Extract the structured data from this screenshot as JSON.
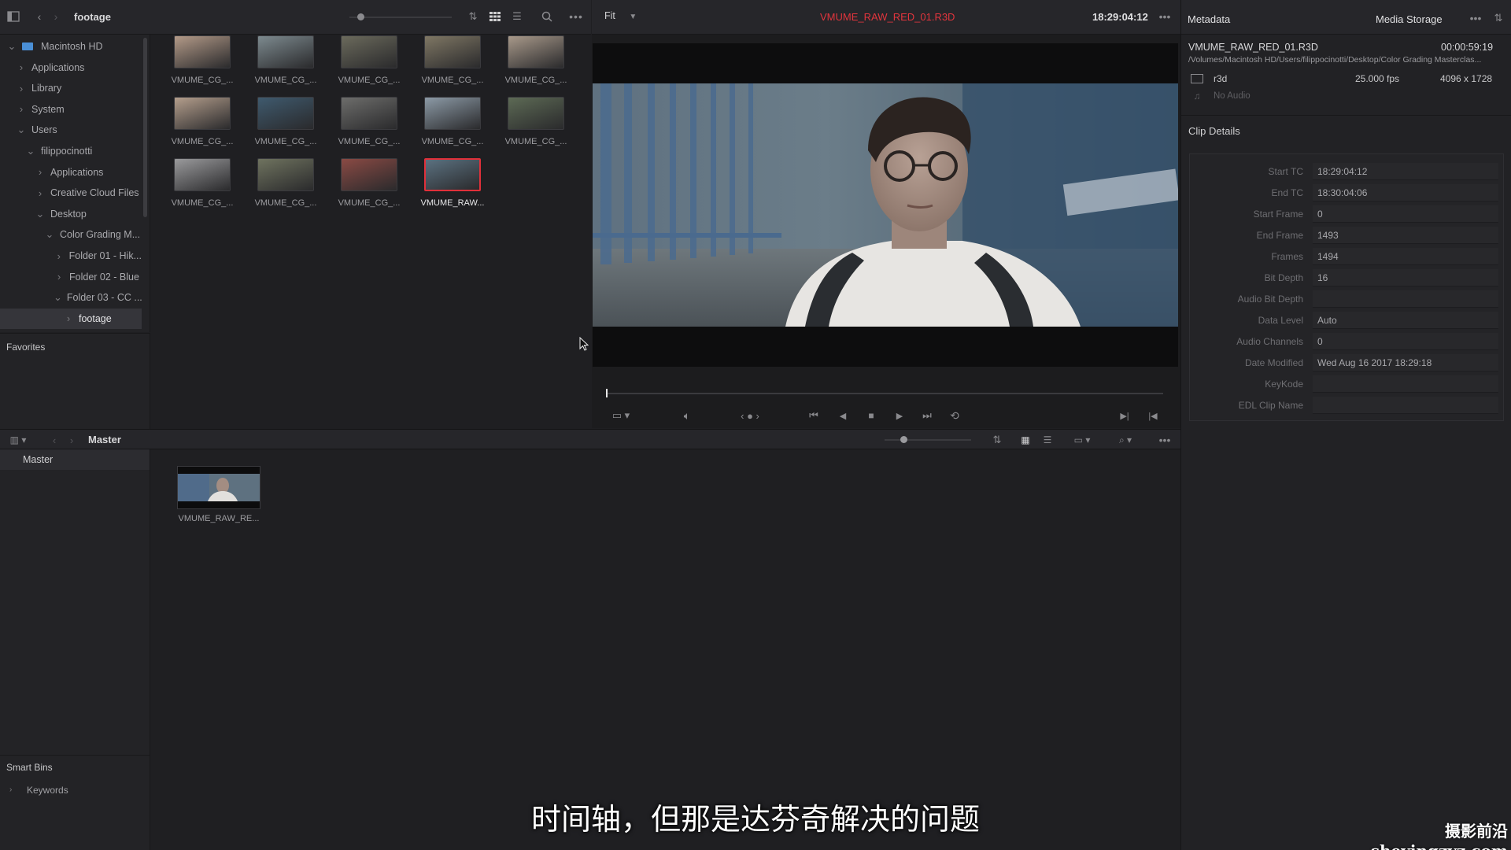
{
  "media_pool": {
    "path_label": "footage",
    "tree": [
      {
        "label": "Macintosh HD",
        "depth": 0,
        "chev": "v",
        "icon": "drive"
      },
      {
        "label": "Applications",
        "depth": 1,
        "chev": ">"
      },
      {
        "label": "Library",
        "depth": 1,
        "chev": ">"
      },
      {
        "label": "System",
        "depth": 1,
        "chev": ">"
      },
      {
        "label": "Users",
        "depth": 1,
        "chev": "v"
      },
      {
        "label": "filippocinotti",
        "depth": 2,
        "chev": "v"
      },
      {
        "label": "Applications",
        "depth": 3,
        "chev": ">"
      },
      {
        "label": "Creative Cloud Files",
        "depth": 3,
        "chev": ">"
      },
      {
        "label": "Desktop",
        "depth": 3,
        "chev": "v"
      },
      {
        "label": "Color Grading M...",
        "depth": 4,
        "chev": "v"
      },
      {
        "label": "Folder 01 - Hik...",
        "depth": 5,
        "chev": ">"
      },
      {
        "label": "Folder 02 - Blue",
        "depth": 5,
        "chev": ">"
      },
      {
        "label": "Folder 03 - CC ...",
        "depth": 5,
        "chev": "v"
      },
      {
        "label": "footage",
        "depth": 6,
        "chev": ">",
        "selected": true
      }
    ],
    "favorites_label": "Favorites",
    "clips": [
      {
        "label": "VMUME_CG_...",
        "color": "#b39a88"
      },
      {
        "label": "VMUME_CG_...",
        "color": "#7d8a8f"
      },
      {
        "label": "VMUME_CG_...",
        "color": "#6b6a5c"
      },
      {
        "label": "VMUME_CG_...",
        "color": "#7f7764"
      },
      {
        "label": "VMUME_CG_...",
        "color": "#a8998a"
      },
      {
        "label": "VMUME_CG_...",
        "color": "#b49e8c"
      },
      {
        "label": "VMUME_CG_...",
        "color": "#3f5a6e"
      },
      {
        "label": "VMUME_CG_...",
        "color": "#6d6d6b"
      },
      {
        "label": "VMUME_CG_...",
        "color": "#8c9aa6"
      },
      {
        "label": "VMUME_CG_...",
        "color": "#5d6a55"
      },
      {
        "label": "VMUME_CG_...",
        "color": "#9a9a9c"
      },
      {
        "label": "VMUME_CG_...",
        "color": "#6f735f"
      },
      {
        "label": "VMUME_CG_...",
        "color": "#8a4a44"
      },
      {
        "label": "VMUME_RAW...",
        "color": "#5b7180",
        "selected": true
      }
    ]
  },
  "viewer": {
    "zoom": "Fit",
    "clip_name": "VMUME_RAW_RED_01.R3D",
    "timecode": "18:29:04:12"
  },
  "metadata": {
    "tab_metadata": "Metadata",
    "tab_media_storage": "Media Storage",
    "file_name": "VMUME_RAW_RED_01.R3D",
    "duration": "00:00:59:19",
    "path": "/Volumes/Macintosh HD/Users/filippocinotti/Desktop/Color Grading Masterclas...",
    "codec": "r3d",
    "fps": "25.000 fps",
    "resolution": "4096 x 1728",
    "audio": "No Audio",
    "section_title": "Clip Details",
    "rows": [
      {
        "k": "Start TC",
        "v": "18:29:04:12"
      },
      {
        "k": "End TC",
        "v": "18:30:04:06"
      },
      {
        "k": "Start Frame",
        "v": "0"
      },
      {
        "k": "End Frame",
        "v": "1493"
      },
      {
        "k": "Frames",
        "v": "1494"
      },
      {
        "k": "Bit Depth",
        "v": "16"
      },
      {
        "k": "Audio Bit Depth",
        "v": ""
      },
      {
        "k": "Data Level",
        "v": "Auto"
      },
      {
        "k": "Audio Channels",
        "v": "0"
      },
      {
        "k": "Date Modified",
        "v": "Wed Aug 16 2017 18:29:18"
      },
      {
        "k": "KeyKode",
        "v": ""
      },
      {
        "k": "EDL Clip Name",
        "v": ""
      }
    ]
  },
  "bin": {
    "title": "Master",
    "sidebar_item": "Master",
    "clip_label": "VMUME_RAW_RE...",
    "smart_bins_label": "Smart Bins",
    "keywords_label": "Keywords"
  },
  "subtitle": "时间轴，但那是达芬奇解决的问题",
  "watermark": "摄影前沿 sheyingzyz.com"
}
